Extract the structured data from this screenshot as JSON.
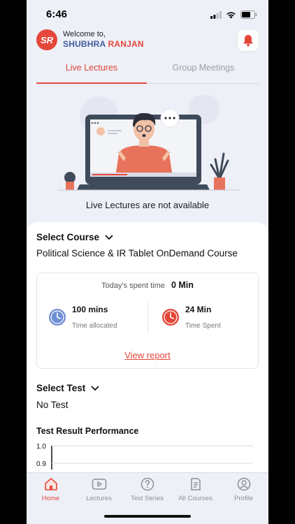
{
  "status_bar": {
    "time": "6:46"
  },
  "header": {
    "logo_text": "SR",
    "welcome": "Welcome to,",
    "name_first": "SHUBHRA",
    "name_last": "RANJAN"
  },
  "tabs": [
    {
      "label": "Live Lectures",
      "active": true
    },
    {
      "label": "Group Meetings",
      "active": false
    }
  ],
  "live_lectures": {
    "empty_message": "Live Lectures are not available"
  },
  "course": {
    "select_label": "Select Course",
    "selected": "Political Science & IR Tablet OnDemand Course",
    "todays_spent_label": "Today's spent time",
    "todays_spent_value": "0 Min",
    "allocated_value": "100 mins",
    "allocated_label": "Time allocated",
    "spent_value": "24 Min",
    "spent_label": "Time Spent",
    "view_report": "View report"
  },
  "test": {
    "select_label": "Select Test",
    "selected": "No Test"
  },
  "performance": {
    "title": "Test Result Performance"
  },
  "chart_data": {
    "type": "line",
    "title": "Test Result Performance",
    "y_ticks": [
      "1.0",
      "0.9"
    ],
    "ylim": [
      0.9,
      1.0
    ],
    "series": [],
    "grid": true
  },
  "colors": {
    "accent": "#e5473a",
    "brand_blue": "#3f5a9a",
    "clock_blue": "#6f8fd4",
    "clock_red": "#e5473a",
    "background": "#eef0f8"
  },
  "bottom_nav": [
    {
      "label": "Home",
      "icon": "home-icon",
      "active": true
    },
    {
      "label": "Lectures",
      "icon": "play-icon",
      "active": false
    },
    {
      "label": "Test Series",
      "icon": "question-icon",
      "active": false
    },
    {
      "label": "All Courses",
      "icon": "document-icon",
      "active": false
    },
    {
      "label": "Profile",
      "icon": "profile-icon",
      "active": false
    }
  ]
}
